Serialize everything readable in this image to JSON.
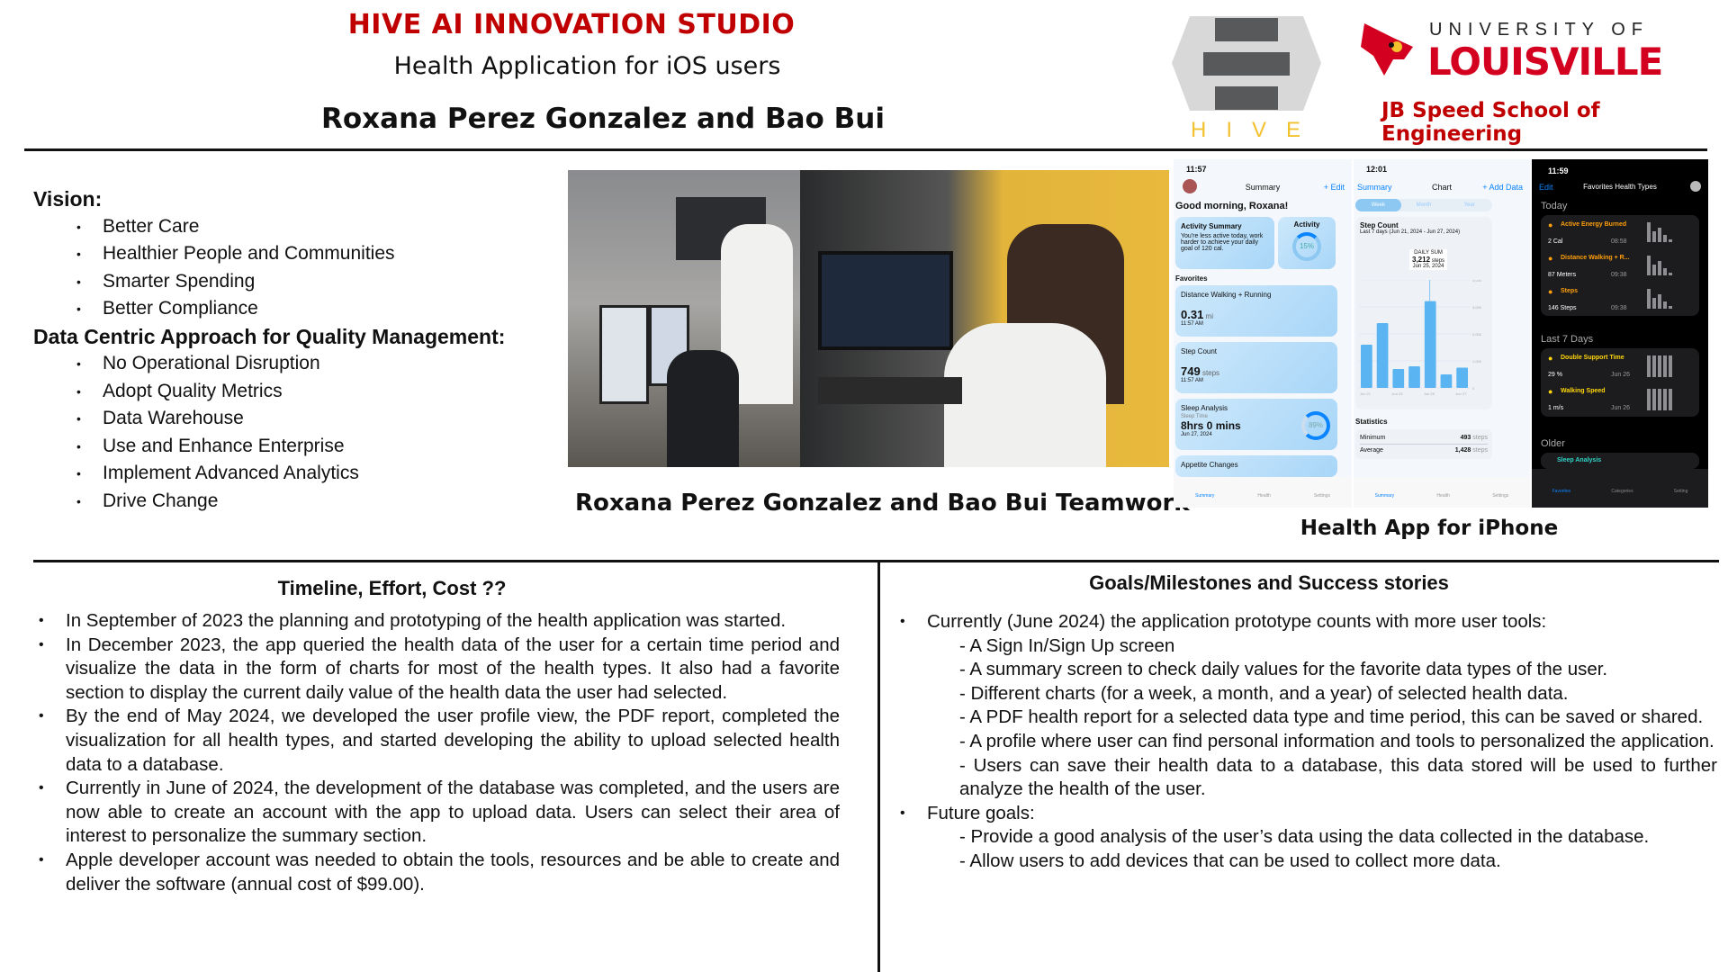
{
  "header": {
    "studio": "HIVE AI INNOVATION STUDIO",
    "subtitle": "Health Application for iOS users",
    "authors": "Roxana Perez Gonzalez and Bao Bui",
    "hive_logo_text": "HIVE",
    "uofl_line1": "UNIVERSITY OF",
    "uofl_line2": "LOUISVILLE",
    "school": "JB Speed School of Engineering"
  },
  "colors": {
    "red": "#c00000",
    "hive_gold": "#f2c12e",
    "ios_blue": "#0a84ff",
    "orange": "#ff9f0a"
  },
  "vision": {
    "heading": "Vision:",
    "items": [
      "Better Care",
      "Healthier People and Communities",
      "Smarter Spending",
      "Better Compliance"
    ],
    "heading2": "Data Centric Approach for Quality Management:",
    "items2": [
      "No Operational Disruption",
      "Adopt Quality Metrics",
      "Data Warehouse",
      "Use and Enhance Enterprise",
      "Implement Advanced Analytics",
      "Drive Change"
    ]
  },
  "photo_caption": "Roxana Perez Gonzalez and Bao Bui Teamwork",
  "phones_caption": "Health App for iPhone",
  "phone1": {
    "time": "11:57",
    "title": "Summary",
    "edit": "+ Edit",
    "greeting": "Good morning, Roxana!",
    "activity_title": "Activity Summary",
    "activity_text": "You're less active today, work harder to achieve your daily goal of 120 cal.",
    "activity_ring_label": "Activity",
    "activity_pct": "15%",
    "favorites": "Favorites",
    "cards": [
      {
        "title": "Distance Walking + Running",
        "value": "0.31",
        "unit": "mi",
        "time": "11:57 AM"
      },
      {
        "title": "Step Count",
        "value": "749",
        "unit": "steps",
        "time": "11:57 AM"
      }
    ],
    "sleep": {
      "title": "Sleep Analysis",
      "label": "Sleep Time",
      "value": "8hrs 0 mins",
      "date": "Jun 27, 2024",
      "pct": "89%"
    },
    "appetite": "Appetite Changes",
    "tabs": [
      "Summary",
      "Health",
      "Settings"
    ]
  },
  "phone2": {
    "time": "12:01",
    "back": "Summary",
    "title": "Chart",
    "add": "+ Add Data",
    "segments": [
      "Week",
      "Month",
      "Year"
    ],
    "chart_title": "Step Count",
    "range": "Last 7 days (Jun 21, 2024 - Jun 27, 2024)",
    "tooltip": {
      "label": "DAILY SUM",
      "value": "3,212",
      "unit": "steps",
      "date": "Jun 25, 2024"
    },
    "chart_data": {
      "type": "bar",
      "categories": [
        "Jun 21",
        "Jun 22",
        "Jun 23",
        "Jun 24",
        "Jun 25",
        "Jun 26",
        "Jun 27"
      ],
      "values": [
        1600,
        2400,
        700,
        800,
        3212,
        500,
        750
      ],
      "ylim": [
        0,
        4000
      ],
      "yticks": [
        "4,000",
        "3,000",
        "2,000",
        "1,000",
        "0"
      ],
      "xticks": [
        "Jun 21",
        "Jun 23",
        "Jun 25",
        "Jun 27"
      ]
    },
    "stats_title": "Statistics",
    "stats": [
      {
        "label": "Minimum",
        "value": "493",
        "unit": "steps"
      },
      {
        "label": "Average",
        "value": "1,428",
        "unit": "steps"
      }
    ],
    "tabs": [
      "Summary",
      "Health",
      "Settings"
    ]
  },
  "phone3": {
    "time": "11:59",
    "edit": "Edit",
    "title": "Favorites Health Types",
    "today": "Today",
    "today_items": [
      {
        "name": "Active Energy Burned",
        "value": "2 Cal",
        "time": "08:58"
      },
      {
        "name": "Distance Walking + R...",
        "value": "87 Meters",
        "time": "09:38"
      },
      {
        "name": "Steps",
        "value": "146 Steps",
        "time": "09:38"
      }
    ],
    "last7": "Last 7 Days",
    "last7_items": [
      {
        "name": "Double Support Time",
        "value": "29 %",
        "time": "Jun 26"
      },
      {
        "name": "Walking Speed",
        "value": "1 m/s",
        "time": "Jun 26"
      }
    ],
    "older": "Older",
    "older_items": [
      {
        "name": "Sleep Analysis"
      }
    ],
    "tabs": [
      "Favorites",
      "Categories",
      "Setting"
    ]
  },
  "timeline": {
    "heading": "Timeline, Effort, Cost ??",
    "items": [
      "In September of 2023 the planning and prototyping of the health application was started.",
      "In December 2023, the app queried the health data of the user for a certain time period and visualize the data in the form of  charts for most of the health types. It also had a favorite section to display the current daily value of the health data the user had selected.",
      "By the end of May 2024, we developed the user profile view, the PDF report, completed the visualization for all health types, and started developing the ability to upload selected health data to a database.",
      "Currently in June of 2024, the development of the database was completed, and the users are now able to create an account with the app to upload data. Users can select their area of interest to personalize the summary section.",
      "Apple developer account was needed to obtain the tools, resources and be able to create and deliver the software (annual  cost of $99.00)."
    ]
  },
  "goals": {
    "heading": "Goals/Milestones and Success stories",
    "current": "Currently (June 2024) the application prototype counts with more user tools:",
    "current_items": [
      "- A Sign In/Sign Up screen",
      "- A summary screen to check daily values for the favorite data types of the user.",
      "- Different charts (for a week, a month, and a year) of selected health data.",
      "- A PDF health report for a selected data type and time period, this can be saved or shared.",
      "- A profile where user can find personal information and tools to personalized the application.",
      "- Users can save their health data to a database, this data stored will be used to further analyze the health of the user."
    ],
    "future": "Future goals:",
    "future_items": [
      "- Provide a good analysis of the user’s data using the data collected in the database.",
      "- Allow users to add devices that can be used to collect more data."
    ]
  }
}
